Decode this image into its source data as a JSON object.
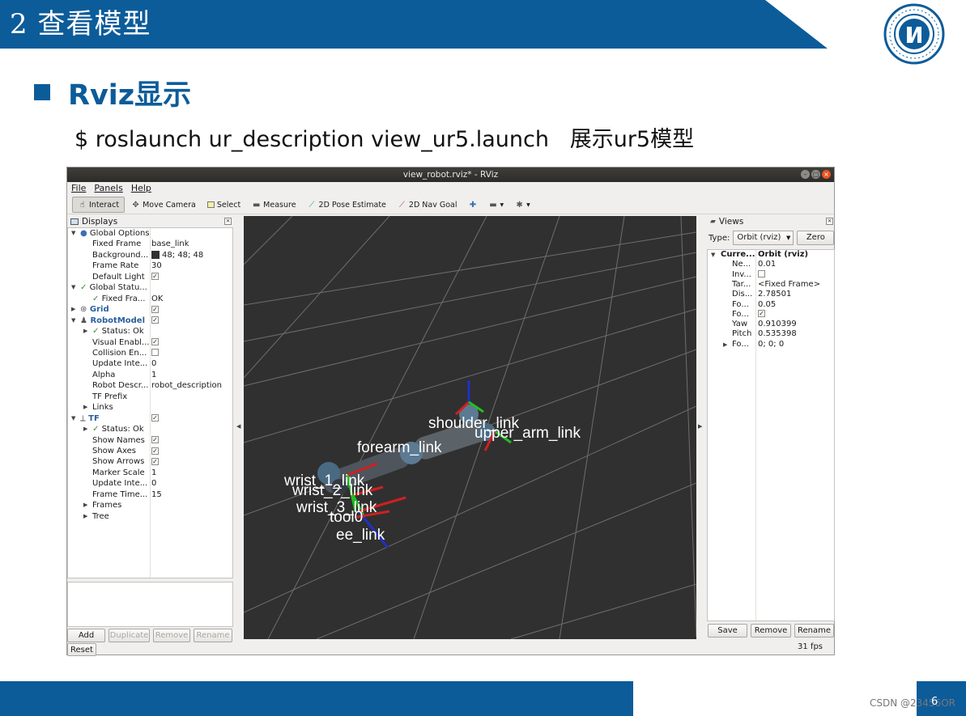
{
  "slide": {
    "title": "2 查看模型",
    "heading": "Rviz显示",
    "command": "$ roslaunch ur_description view_ur5.launch   展示ur5模型",
    "page_number": "6",
    "watermark": "CSDN @23456OR",
    "accent_color": "#0c5c9a"
  },
  "rviz": {
    "window_title": "view_robot.rviz* - RViz",
    "menu": [
      "File",
      "Panels",
      "Help"
    ],
    "toolbar": [
      {
        "label": "Interact",
        "icon": "cursor-icon",
        "active": true
      },
      {
        "label": "Move Camera",
        "icon": "move-camera-icon"
      },
      {
        "label": "Select",
        "icon": "select-icon"
      },
      {
        "label": "Measure",
        "icon": "measure-icon"
      },
      {
        "label": "2D Pose Estimate",
        "icon": "pose-estimate-icon"
      },
      {
        "label": "2D Nav Goal",
        "icon": "nav-goal-icon"
      }
    ],
    "displays": {
      "title": "Displays",
      "rows": [
        {
          "name": "Global Options"
        },
        {
          "name": "Fixed Frame",
          "value": "base_link"
        },
        {
          "name": "Background...",
          "value": "48; 48; 48"
        },
        {
          "name": "Frame Rate",
          "value": "30"
        },
        {
          "name": "Default Light",
          "value": ""
        },
        {
          "name": "Global Statu...",
          "value": ""
        },
        {
          "name": "Fixed Fra...",
          "value": "OK"
        },
        {
          "name": "Grid",
          "value": ""
        },
        {
          "name": "RobotModel",
          "value": ""
        },
        {
          "name": "Status: Ok",
          "value": ""
        },
        {
          "name": "Visual Enabl...",
          "value": ""
        },
        {
          "name": "Collision En...",
          "value": ""
        },
        {
          "name": "Update Inte...",
          "value": "0"
        },
        {
          "name": "Alpha",
          "value": "1"
        },
        {
          "name": "Robot Descr...",
          "value": "robot_description"
        },
        {
          "name": "TF Prefix",
          "value": ""
        },
        {
          "name": "Links",
          "value": ""
        },
        {
          "name": "TF",
          "value": ""
        },
        {
          "name": "Status: Ok",
          "value": ""
        },
        {
          "name": "Show Names",
          "value": ""
        },
        {
          "name": "Show Axes",
          "value": ""
        },
        {
          "name": "Show Arrows",
          "value": ""
        },
        {
          "name": "Marker Scale",
          "value": "1"
        },
        {
          "name": "Update Inte...",
          "value": "0"
        },
        {
          "name": "Frame Time...",
          "value": "15"
        },
        {
          "name": "Frames",
          "value": ""
        },
        {
          "name": "Tree",
          "value": ""
        }
      ],
      "buttons": {
        "add": "Add",
        "duplicate": "Duplicate",
        "remove": "Remove",
        "rename": "Rename",
        "reset": "Reset"
      }
    },
    "viewport": {
      "background_color": "#303030",
      "frame_labels": [
        "shoulder_link",
        "upper_arm_link",
        "forearm_link",
        "wrist_1_link",
        "wrist_2_link",
        "wrist_3_link",
        "tool0",
        "ee_link"
      ]
    },
    "views": {
      "title": "Views",
      "type_label": "Type:",
      "type_value": "Orbit (rviz)",
      "zero_button": "Zero",
      "rows": [
        {
          "name": "Curre...",
          "value": "Orbit (rviz)"
        },
        {
          "name": "Ne...",
          "value": "0.01"
        },
        {
          "name": "Inv...",
          "value": ""
        },
        {
          "name": "Tar...",
          "value": "<Fixed Frame>"
        },
        {
          "name": "Dis...",
          "value": "2.78501"
        },
        {
          "name": "Fo...",
          "value": "0.05"
        },
        {
          "name": "Fo...",
          "value": ""
        },
        {
          "name": "Yaw",
          "value": "0.910399"
        },
        {
          "name": "Pitch",
          "value": "0.535398"
        },
        {
          "name": "Fo...",
          "value": "0; 0; 0"
        }
      ],
      "buttons": {
        "save": "Save",
        "remove": "Remove",
        "rename": "Rename"
      },
      "fps": "31 fps"
    }
  }
}
